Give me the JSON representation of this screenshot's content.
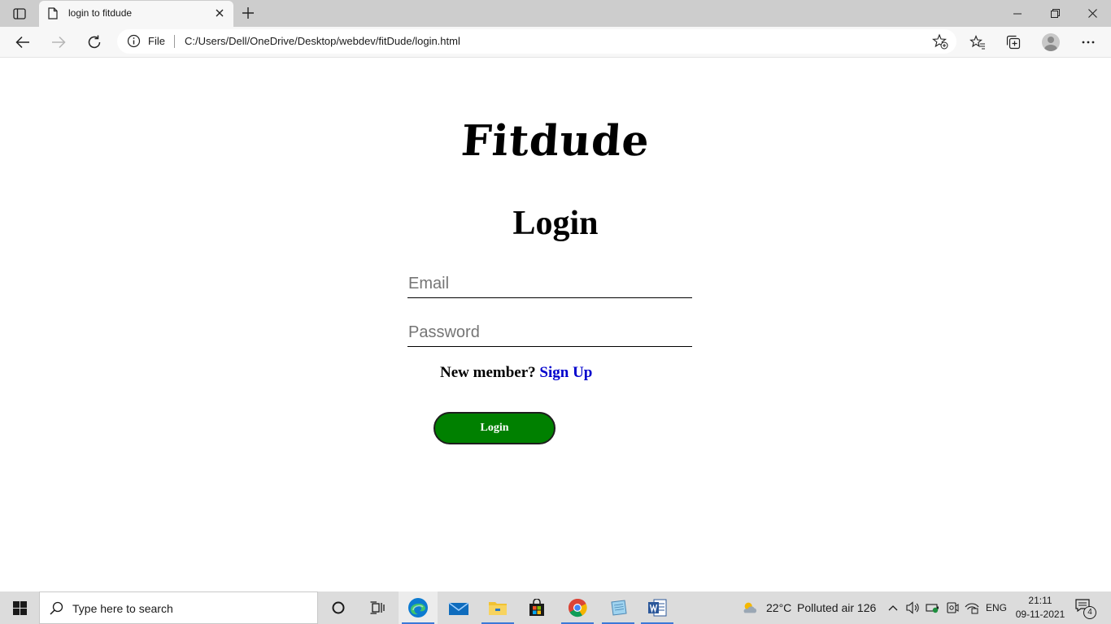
{
  "browser": {
    "tab_title": "login to fitdude",
    "address_scheme": "File",
    "address_url": "C:/Users/Dell/OneDrive/Desktop/webdev/fitDude/login.html"
  },
  "page": {
    "brand": "Fitdude",
    "heading": "Login",
    "email_placeholder": "Email",
    "password_placeholder": "Password",
    "member_prompt": "New member?",
    "signup_link": "Sign Up",
    "login_button": "Login"
  },
  "taskbar": {
    "search_placeholder": "Type here to search",
    "temperature": "22°C",
    "air_quality": "Polluted air 126",
    "language": "ENG",
    "time": "21:11",
    "date": "09-11-2021",
    "notification_count": "4"
  },
  "colors": {
    "login_button": "#008000",
    "link": "#0000cc"
  }
}
